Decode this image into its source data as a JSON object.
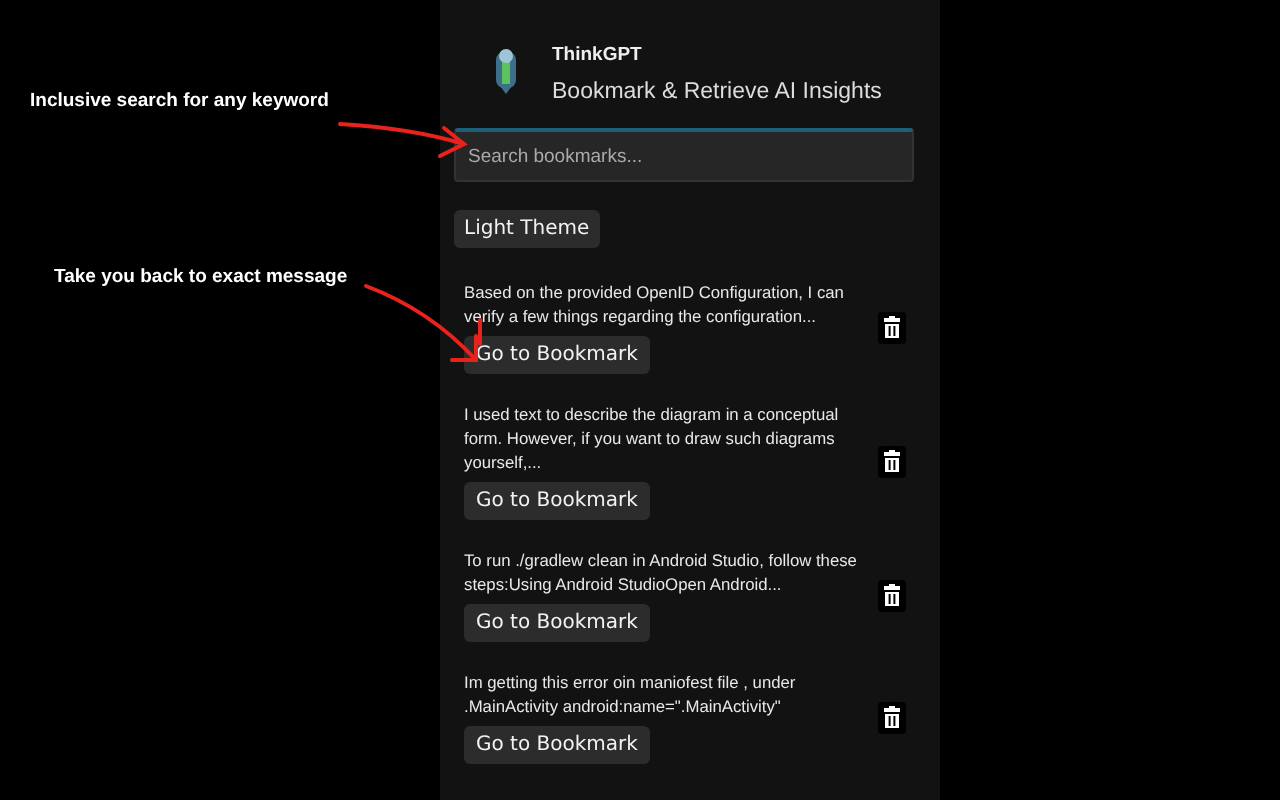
{
  "annotations": [
    {
      "text": "Inclusive search for any keyword"
    },
    {
      "text": "Take you back to exact message"
    }
  ],
  "app": {
    "title": "ThinkGPT",
    "subtitle": "Bookmark & Retrieve AI Insights"
  },
  "search": {
    "placeholder": "Search bookmarks..."
  },
  "theme_button": {
    "label": "Light Theme"
  },
  "bookmarks": [
    {
      "text": "Based on the provided OpenID Configuration, I can verify a few things regarding the configuration...",
      "button": "Go to Bookmark"
    },
    {
      "text": "I used text to describe the diagram in a conceptual form. However, if you want to draw such diagrams yourself,...",
      "button": "Go to Bookmark"
    },
    {
      "text": "To run ./gradlew clean in Android Studio, follow these steps:Using Android StudioOpen Android...",
      "button": "Go to Bookmark"
    },
    {
      "text": "Im getting this error oin maniofest file , under .MainActivity android:name=\".MainActivity\"",
      "button": "Go to Bookmark"
    }
  ]
}
